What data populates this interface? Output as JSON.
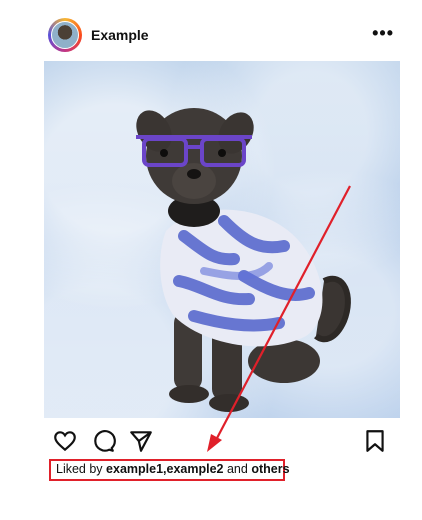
{
  "post": {
    "username": "Example",
    "more_label": "•••"
  },
  "actions": {
    "like_icon": "heart-icon",
    "comment_icon": "comment-icon",
    "share_icon": "send-icon",
    "save_icon": "bookmark-icon"
  },
  "likes": {
    "prefix": "Liked by",
    "users": "example1,example2",
    "conjunction": "and",
    "others": "others"
  },
  "annotation": {
    "color": "#e0202a"
  }
}
